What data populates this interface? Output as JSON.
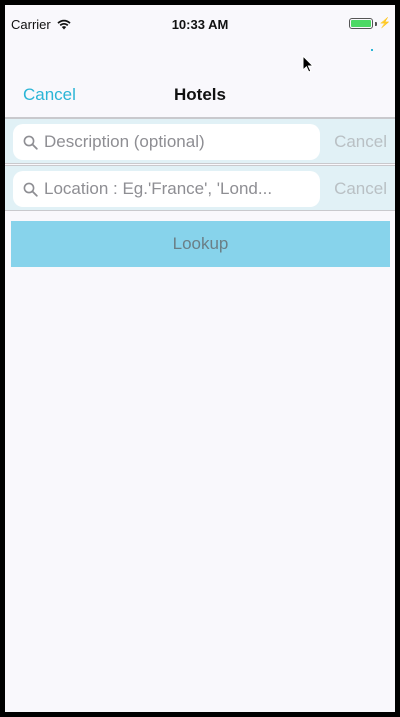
{
  "status_bar": {
    "carrier": "Carrier",
    "time": "10:33 AM",
    "battery_icon": "battery-icon",
    "wifi_icon": "wifi-icon"
  },
  "nav": {
    "cancel_label": "Cancel",
    "title": "Hotels"
  },
  "description_search": {
    "value": "",
    "placeholder": "Description (optional)",
    "cancel_label": "Cancel",
    "icon": "search-icon"
  },
  "location_search": {
    "value": "",
    "placeholder": "Location : Eg.'France', 'Lond...",
    "cancel_label": "Cancel",
    "icon": "search-icon"
  },
  "lookup": {
    "label": "Lookup"
  },
  "colors": {
    "accent": "#2bb5d6",
    "button_bg": "#87d3eb",
    "search_bar_bg": "#e1f1f6",
    "background": "#f9f8fc"
  }
}
